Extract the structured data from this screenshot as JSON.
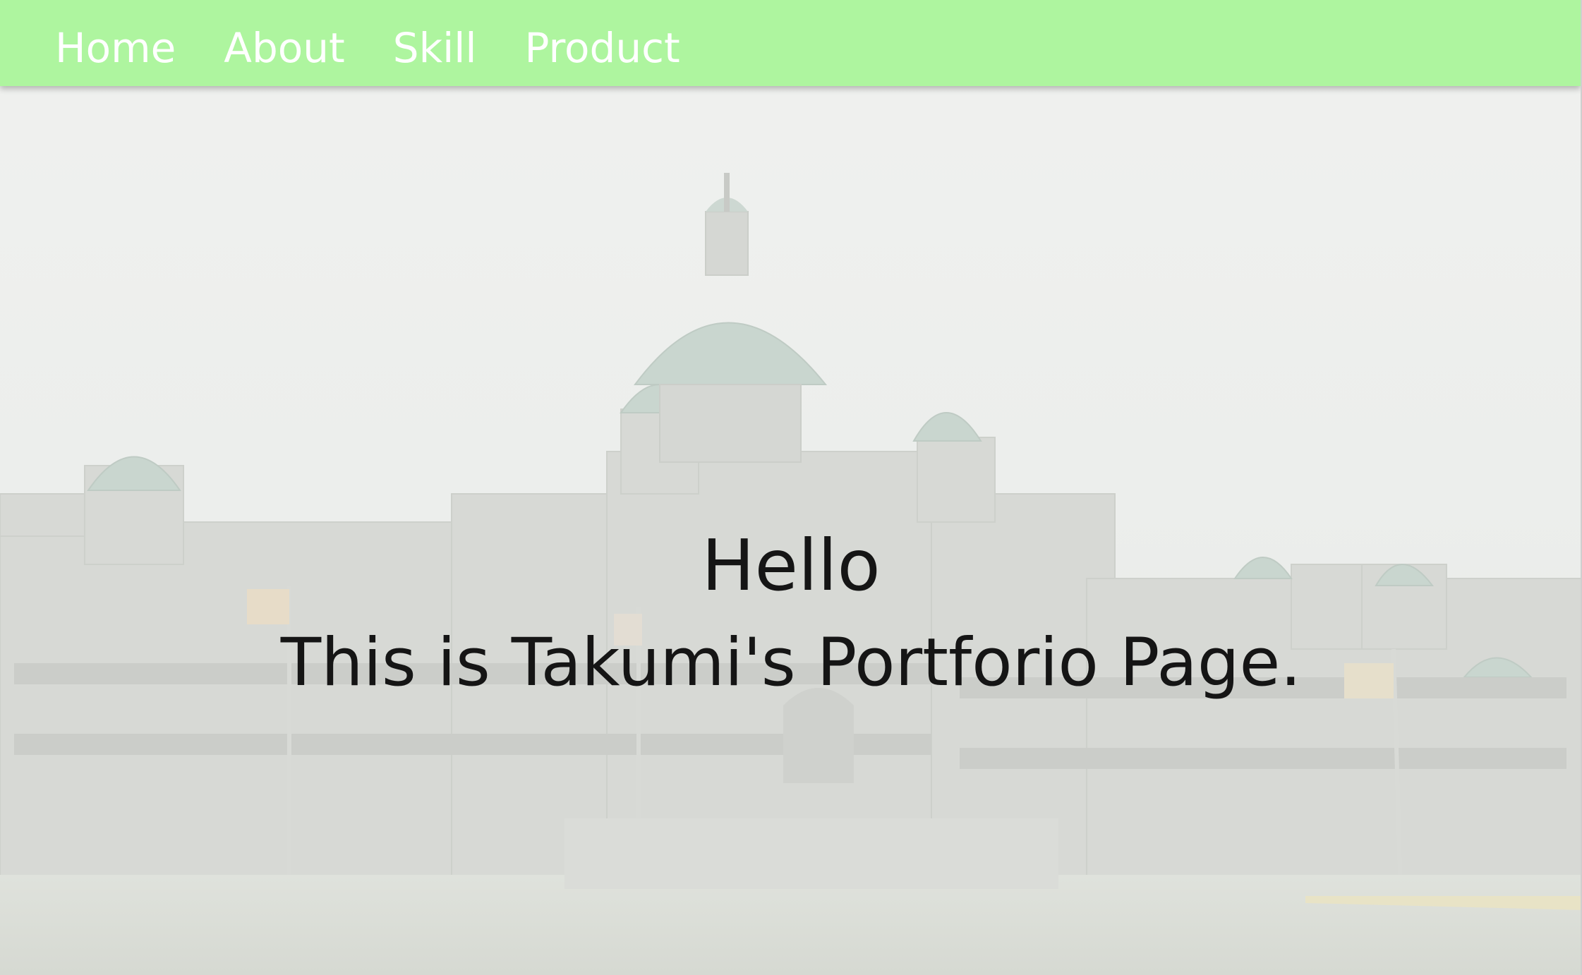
{
  "navbar": {
    "items": [
      {
        "label": "Home"
      },
      {
        "label": "About"
      },
      {
        "label": "Skill"
      },
      {
        "label": "Product"
      }
    ],
    "background": "#aef59f",
    "text_color": "#ffffff"
  },
  "hero": {
    "greeting": "Hello",
    "subtitle": "This is Takumi's Portforio Page.",
    "text_color": "#151515",
    "background_image": "faded photo of a domed parliament building"
  }
}
